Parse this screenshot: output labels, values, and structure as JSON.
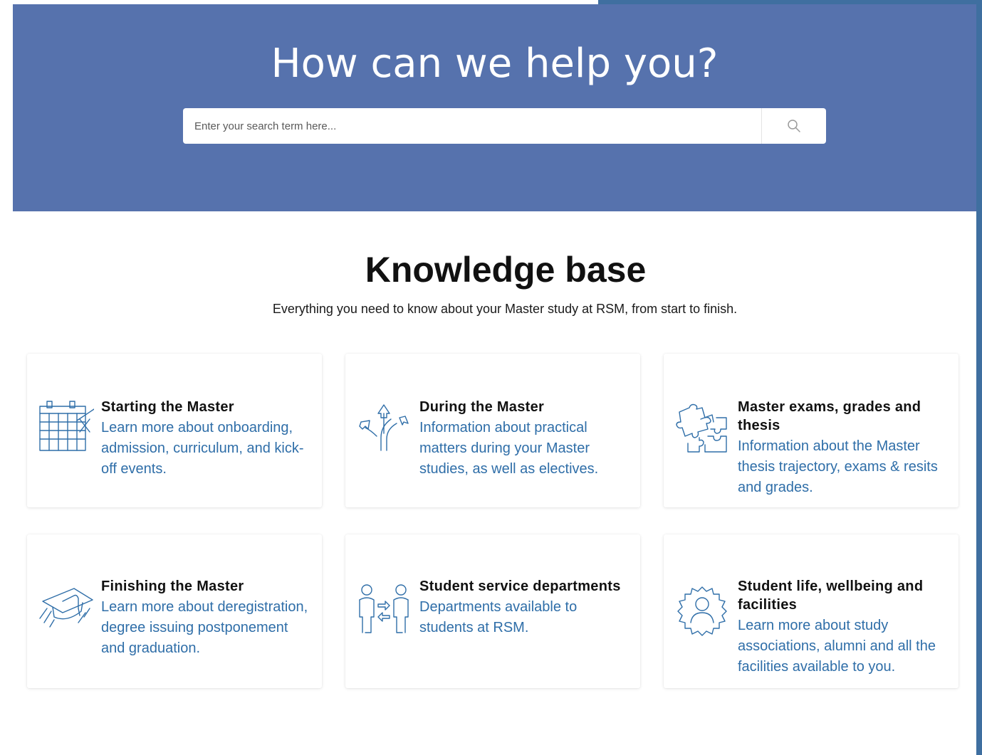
{
  "hero": {
    "title": "How can we help you?",
    "search": {
      "placeholder": "Enter your search term here...",
      "button_icon": "search-icon"
    }
  },
  "knowledge_base": {
    "title": "Knowledge base",
    "subtitle": "Everything you need to know about your Master study at RSM, from start to finish.",
    "cards": [
      {
        "icon": "calendar-icon",
        "title": "Starting the Master",
        "description": "Learn more about onboarding, admission, curriculum, and kick-off events."
      },
      {
        "icon": "crossroads-arrows-icon",
        "title": "During the Master",
        "description": "Information about practical matters during your Master studies, as well as electives."
      },
      {
        "icon": "puzzle-icon",
        "title": "Master exams, grades and thesis",
        "description": "Information about the Master thesis trajectory, exams & resits and grades."
      },
      {
        "icon": "graduation-cap-icon",
        "title": "Finishing the Master",
        "description": "Learn more about deregistration, degree issuing postponement and graduation."
      },
      {
        "icon": "people-exchange-icon",
        "title": "Student service departments",
        "description": "Departments available to students at RSM."
      },
      {
        "icon": "person-badge-icon",
        "title": "Student life, wellbeing and facilities",
        "description": "Learn more about study associations, alumni and all the facilities available to you."
      }
    ]
  },
  "colors": {
    "hero_background": "#5672ad",
    "frame": "#3f6fa0",
    "link_blue": "#2f6ea8",
    "title_dark": "#111111"
  }
}
